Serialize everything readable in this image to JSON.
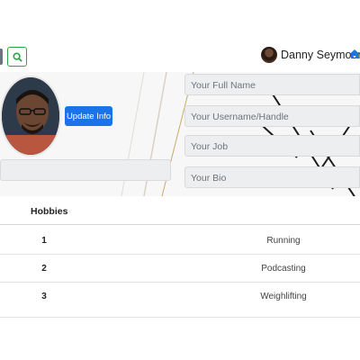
{
  "navbar": {
    "user_name": "Danny Seymour",
    "icons": [
      "search-icon",
      "avatar",
      "home-icon"
    ],
    "search_color": "#28a745",
    "accent": "#1a73e8"
  },
  "profile": {
    "update_button": "Update Info",
    "fields": [
      {
        "name": "full-name-field",
        "placeholder": "Your Full Name"
      },
      {
        "name": "username-field",
        "placeholder": "Your Username/Handle"
      },
      {
        "name": "job-field",
        "placeholder": "Your Job"
      },
      {
        "name": "bio-field",
        "placeholder": "Your Bio"
      }
    ]
  },
  "table": {
    "header": "Hobbies",
    "rows": [
      {
        "num": "1",
        "hobby": "Running"
      },
      {
        "num": "2",
        "hobby": "Podcasting"
      },
      {
        "num": "3",
        "hobby": "Weighlifting"
      }
    ]
  }
}
